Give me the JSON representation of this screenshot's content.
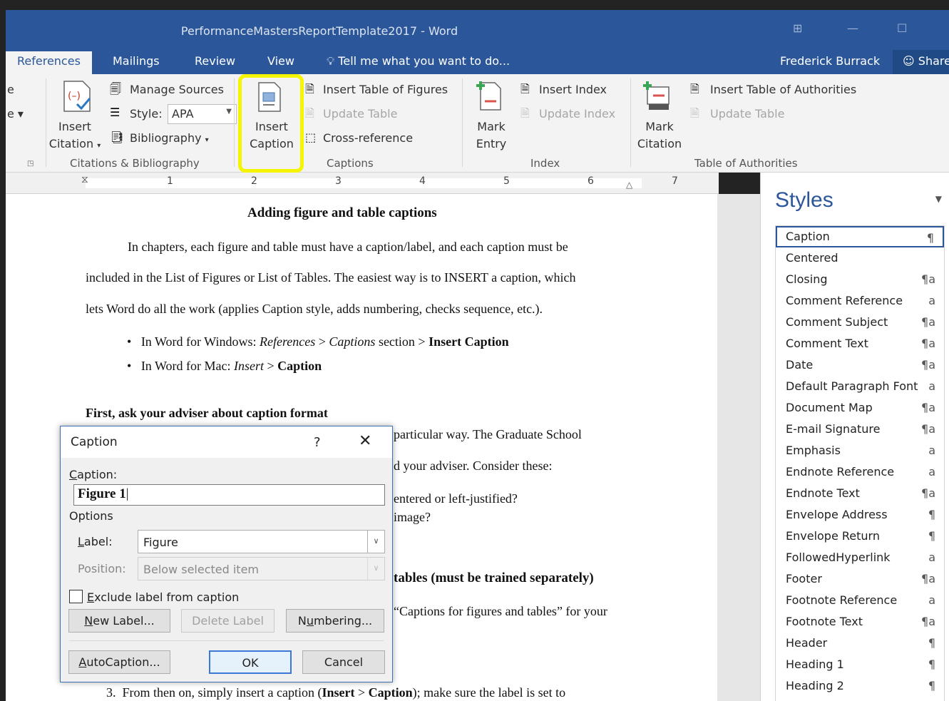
{
  "window": {
    "title": "PerformanceMastersReportTemplate2017 - Word"
  },
  "tabs": [
    {
      "label": "References",
      "active": true
    },
    {
      "label": "Mailings"
    },
    {
      "label": "Review"
    },
    {
      "label": "View"
    }
  ],
  "tell_me": "Tell me what you want to do...",
  "user": "Frederick Burrack",
  "share": "Share",
  "ribbon": {
    "insert_citation": [
      "Insert",
      "Citation"
    ],
    "manage_sources": "Manage Sources",
    "style_label": "Style:",
    "style_value": "APA",
    "bibliography": "Bibliography",
    "citations_group": "Citations & Bibliography",
    "insert_caption": [
      "Insert",
      "Caption"
    ],
    "insert_table_of_figures": "Insert Table of Figures",
    "update_table": "Update Table",
    "cross_reference": "Cross-reference",
    "captions_group": "Captions",
    "mark_entry": [
      "Mark",
      "Entry"
    ],
    "insert_index": "Insert Index",
    "update_index": "Update Index",
    "index_group": "Index",
    "mark_citation": [
      "Mark",
      "Citation"
    ],
    "insert_table_of_authorities": "Insert Table of Authorities",
    "update_table_toa": "Update Table",
    "toa_group": "Table of Authorities",
    "left_cut_1": "e",
    "left_cut_2": "e"
  },
  "ruler": {
    "numbers": [
      "1",
      "2",
      "3",
      "4",
      "5",
      "6",
      "7"
    ]
  },
  "document": {
    "heading": "Adding figure and table captions",
    "p1": "In chapters, each figure and table must have a caption/label, and each caption must be",
    "p2": "included in the List of Figures or List of Tables.  The easiest way is to INSERT a caption, which",
    "p3": "lets Word do all the work (applies Caption style, adds numbering, checks sequence, etc.).",
    "b1_pre": "In Word for Windows:  ",
    "b1_i1": "References",
    "b1_mid1": " > ",
    "b1_i2": "Captions",
    "b1_mid2": " section > ",
    "b1_b": "Insert Caption",
    "b2_pre": "In Word for Mac:  ",
    "b2_i": "Insert",
    "b2_mid": " > ",
    "b2_b": "Caption",
    "sub1": "First, ask your adviser about caption format",
    "frag1": "particular way.  The Graduate School",
    "frag2": "d your adviser.  Consider these:",
    "frag3": "entered or left-justified?",
    "frag4": "image?",
    "frag5": "tables (must be trained separately)",
    "frag6": "“Captions for figures and tables” for your",
    "step3_num": "3.",
    "step3_pre": "From then on, simply insert a caption (",
    "step3_b1": "Insert",
    "step3_mid": " > ",
    "step3_b2": "Caption",
    "step3_post": "); make sure the label is set to"
  },
  "styles_pane": {
    "title": "Styles",
    "items": [
      {
        "name": "Caption",
        "sym": "¶",
        "selected": true
      },
      {
        "name": "Centered",
        "sym": ""
      },
      {
        "name": "Closing",
        "sym": "¶a"
      },
      {
        "name": "Comment Reference",
        "sym": "a"
      },
      {
        "name": "Comment Subject",
        "sym": "¶a"
      },
      {
        "name": "Comment Text",
        "sym": "¶a"
      },
      {
        "name": "Date",
        "sym": "¶a"
      },
      {
        "name": "Default Paragraph Font",
        "sym": "a"
      },
      {
        "name": "Document Map",
        "sym": "¶a"
      },
      {
        "name": "E-mail Signature",
        "sym": "¶a"
      },
      {
        "name": "Emphasis",
        "sym": "a"
      },
      {
        "name": "Endnote Reference",
        "sym": "a"
      },
      {
        "name": "Endnote Text",
        "sym": "¶a"
      },
      {
        "name": "Envelope Address",
        "sym": "¶"
      },
      {
        "name": "Envelope Return",
        "sym": "¶"
      },
      {
        "name": "FollowedHyperlink",
        "sym": "a"
      },
      {
        "name": "Footer",
        "sym": "¶a"
      },
      {
        "name": "Footnote Reference",
        "sym": "a"
      },
      {
        "name": "Footnote Text",
        "sym": "¶a"
      },
      {
        "name": "Header",
        "sym": "¶"
      },
      {
        "name": "Heading 1",
        "sym": "¶"
      },
      {
        "name": "Heading 2",
        "sym": "¶"
      }
    ]
  },
  "dialog": {
    "title": "Caption",
    "help": "?",
    "caption_label": "Caption:",
    "caption_value": "Figure 1",
    "options_label": "Options",
    "label_label": "Label:",
    "label_value": "Figure",
    "position_label": "Position:",
    "position_value": "Below selected item",
    "exclude_label": "Exclude label from caption",
    "new_label": "New Label...",
    "delete_label": "Delete Label",
    "numbering": "Numbering...",
    "autocaption": "AutoCaption...",
    "ok": "OK",
    "cancel": "Cancel"
  },
  "colors": {
    "word_blue": "#2b579a",
    "highlight": "#f5f500"
  }
}
